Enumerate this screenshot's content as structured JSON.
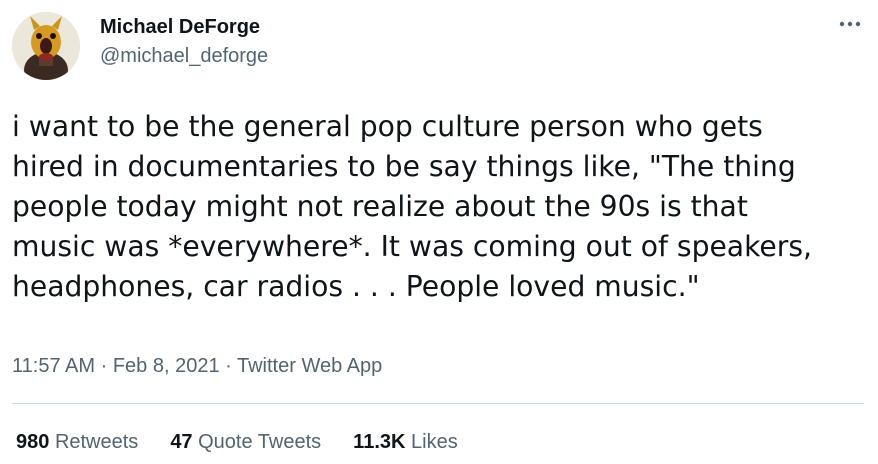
{
  "author": {
    "display_name": "Michael DeForge",
    "handle": "@michael_deforge"
  },
  "more_icon": "more-horizontal-icon",
  "tweet": {
    "text": "i want to be the general pop culture person who gets\nhired in documentaries to be say things like, \"The thing\npeople today might not realize about the 90s is that\nmusic was *everywhere*. It was coming out of speakers,\nheadphones, car radios . . . People loved music.\"",
    "time": "11:57 AM",
    "separator1": " · ",
    "date": "Feb 8, 2021",
    "separator2": " · ",
    "source": "Twitter Web App"
  },
  "stats": {
    "retweets_count": "980",
    "retweets_label": "Retweets",
    "quote_count": "47",
    "quote_label": "Quote Tweets",
    "likes_count": "11.3K",
    "likes_label": "Likes"
  },
  "colors": {
    "text_primary": "#0f1419",
    "text_secondary": "#536471",
    "divider": "#cfd9de"
  }
}
